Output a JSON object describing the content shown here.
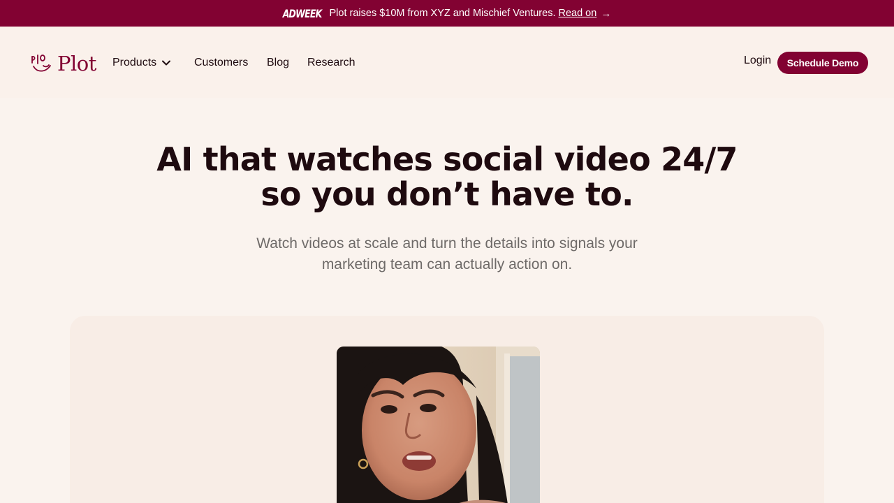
{
  "announcement": {
    "logo_text": "ADWEEK",
    "text": "Plot raises $10M from XYZ and Mischief Ventures.",
    "link_label": "Read on",
    "arrow": "→"
  },
  "header": {
    "brand": "Plot",
    "nav": {
      "products": "Products",
      "customers": "Customers",
      "blog": "Blog",
      "research": "Research"
    },
    "login": "Login",
    "cta": "Schedule Demo"
  },
  "hero": {
    "title_line1": "AI that watches social video 24/7",
    "title_line2": "so you don’t have to.",
    "subtitle_line1": "Watch videos at scale and turn the details into signals your",
    "subtitle_line2": "marketing team can actually action on."
  },
  "colors": {
    "brand": "#820232",
    "background": "#faf3ee",
    "text": "#1e0a0f",
    "muted": "#6e6a68"
  },
  "icons": {
    "logo_mark": "plot-logo-icon",
    "products_dropdown": "chevron-down-icon",
    "announcement_arrow": "arrow-right-icon"
  }
}
